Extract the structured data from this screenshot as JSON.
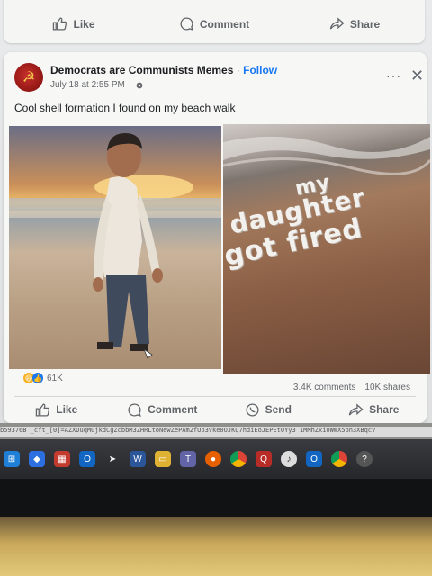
{
  "prev_post": {
    "actions": {
      "like": "Like",
      "comment": "Comment",
      "share": "Share"
    }
  },
  "post": {
    "page_name": "Democrats are Communists Memes",
    "separator": "·",
    "follow": "Follow",
    "timestamp": "July 18 at 2:55 PM",
    "caption": "Cool shell formation I found on my beach walk",
    "image_right_text": [
      "my",
      "daughter",
      "got fired"
    ],
    "reactions_count": "61K",
    "comments_count": "3.4K comments",
    "shares_count": "10K shares",
    "actions": {
      "like": "Like",
      "comment": "Comment",
      "send": "Send",
      "share": "Share"
    },
    "more": "···",
    "close": "✕"
  },
  "url_strip": "b59376B _cft_[0]=AZXDuqMGjkdCgZcbbM3ZHRLtoNewZePAm2fUp3Vke0OJKQ7hdiEoJEPEtOYy3 1MMhZxi0WWX5pn3XBqcV",
  "taskbar": {
    "icons": [
      "windows-icon",
      "dropbox-icon",
      "calendar-icon",
      "outlook-icon",
      "arrow-app-icon",
      "word-icon",
      "folder-icon",
      "teams-icon",
      "firefox-icon",
      "chrome-icon",
      "quora-icon",
      "music-icon",
      "outlook2-icon",
      "chrome2-icon",
      "help-icon"
    ]
  },
  "colors": {
    "link_blue": "#1877f2",
    "text_dark": "#1c1e21",
    "text_muted": "#65676b",
    "card_bg": "#f7f7f6"
  }
}
